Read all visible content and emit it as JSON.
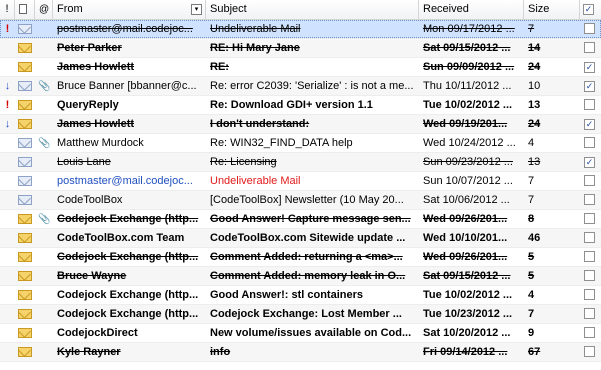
{
  "header": {
    "columns": [
      {
        "key": "flag",
        "label": "!"
      },
      {
        "key": "doc",
        "label": ""
      },
      {
        "key": "att",
        "label": "@"
      },
      {
        "key": "from",
        "label": "From"
      },
      {
        "key": "subject",
        "label": "Subject"
      },
      {
        "key": "received",
        "label": "Received"
      },
      {
        "key": "size",
        "label": "Size"
      },
      {
        "key": "check",
        "label": ""
      }
    ]
  },
  "rows": [
    {
      "priority": "!",
      "priority_type": "high",
      "read": true,
      "attach": false,
      "from": "postmaster@mail.codejoc...",
      "subject": "Undeliverable Mail",
      "received": "Mon 09/17/2012 ...",
      "size": "7",
      "checked": false,
      "bold": false,
      "strike": true,
      "from_color": "",
      "subject_color": "",
      "selected": true
    },
    {
      "priority": "",
      "priority_type": "",
      "read": false,
      "attach": false,
      "from": "Peter Parker",
      "subject": "RE: Hi Mary Jane",
      "received": "Sat 09/15/2012 ...",
      "size": "14",
      "checked": false,
      "bold": true,
      "strike": true,
      "from_color": "",
      "subject_color": "",
      "selected": false
    },
    {
      "priority": "",
      "priority_type": "",
      "read": false,
      "attach": false,
      "from": "James Howlett",
      "subject": "RE:",
      "received": "Sun 09/09/2012 ...",
      "size": "24",
      "checked": true,
      "bold": true,
      "strike": true,
      "from_color": "",
      "subject_color": "",
      "selected": false
    },
    {
      "priority": "↓",
      "priority_type": "low",
      "read": true,
      "attach": true,
      "from": "Bruce Banner [bbanner@c...",
      "subject": "Re: error C2039: 'Serialize' : is not a me...",
      "received": "Thu 10/11/2012 ...",
      "size": "10",
      "checked": true,
      "bold": false,
      "strike": false,
      "from_color": "",
      "subject_color": "",
      "selected": false
    },
    {
      "priority": "!",
      "priority_type": "high",
      "read": false,
      "attach": false,
      "from": "QueryReply",
      "subject": "Re: Download GDI+ version 1.1",
      "received": "Tue 10/02/2012 ...",
      "size": "13",
      "checked": false,
      "bold": true,
      "strike": false,
      "from_color": "",
      "subject_color": "",
      "selected": false
    },
    {
      "priority": "↓",
      "priority_type": "low",
      "read": false,
      "attach": false,
      "from": "James Howlett",
      "subject": "I don't understand:",
      "received": "Wed 09/19/201...",
      "size": "24",
      "checked": true,
      "bold": true,
      "strike": true,
      "from_color": "",
      "subject_color": "",
      "selected": false
    },
    {
      "priority": "",
      "priority_type": "",
      "read": true,
      "attach": true,
      "from": "Matthew Murdock",
      "subject": "Re: WIN32_FIND_DATA help",
      "received": "Wed 10/24/2012 ...",
      "size": "4",
      "checked": false,
      "bold": false,
      "strike": false,
      "from_color": "",
      "subject_color": "",
      "selected": false
    },
    {
      "priority": "",
      "priority_type": "",
      "read": true,
      "attach": false,
      "from": "Louis Lane",
      "subject": "Re: Licensing",
      "received": "Sun 09/23/2012 ...",
      "size": "13",
      "checked": true,
      "bold": false,
      "strike": true,
      "from_color": "",
      "subject_color": "",
      "selected": false
    },
    {
      "priority": "",
      "priority_type": "",
      "read": true,
      "attach": false,
      "from": "postmaster@mail.codejoc...",
      "subject": "Undeliverable Mail",
      "received": "Sun 10/07/2012 ...",
      "size": "7",
      "checked": false,
      "bold": false,
      "strike": false,
      "from_color": "#1f4fbf",
      "subject_color": "#e21a1a",
      "selected": false
    },
    {
      "priority": "",
      "priority_type": "",
      "read": true,
      "attach": false,
      "from": "CodeToolBox",
      "subject": "[CodeToolBox] Newsletter (10 May 20...",
      "received": "Sat 10/06/2012 ...",
      "size": "7",
      "checked": false,
      "bold": false,
      "strike": false,
      "from_color": "",
      "subject_color": "",
      "selected": false
    },
    {
      "priority": "",
      "priority_type": "",
      "read": false,
      "attach": true,
      "from": "Codejock Exchange (http...",
      "subject": "Good Answer! Capture message sen...",
      "received": "Wed 09/26/201...",
      "size": "8",
      "checked": false,
      "bold": true,
      "strike": true,
      "from_color": "",
      "subject_color": "",
      "selected": false
    },
    {
      "priority": "",
      "priority_type": "",
      "read": false,
      "attach": false,
      "from": "CodeToolBox.com Team",
      "subject": "CodeToolBox.com Sitewide update ...",
      "received": "Wed 10/10/201...",
      "size": "46",
      "checked": false,
      "bold": true,
      "strike": false,
      "from_color": "",
      "subject_color": "",
      "selected": false
    },
    {
      "priority": "",
      "priority_type": "",
      "read": false,
      "attach": false,
      "from": "Codejock Exchange (http...",
      "subject": "Comment Added: returning a <ma>...",
      "received": "Wed 09/26/201...",
      "size": "5",
      "checked": false,
      "bold": true,
      "strike": true,
      "from_color": "",
      "subject_color": "",
      "selected": false
    },
    {
      "priority": "",
      "priority_type": "",
      "read": false,
      "attach": false,
      "from": "Bruce Wayne",
      "subject": "Comment Added: memory leak in O...",
      "received": "Sat 09/15/2012 ...",
      "size": "5",
      "checked": false,
      "bold": true,
      "strike": true,
      "from_color": "",
      "subject_color": "",
      "selected": false
    },
    {
      "priority": "",
      "priority_type": "",
      "read": false,
      "attach": false,
      "from": "Codejock Exchange (http...",
      "subject": "Good Answer!: stl containers",
      "received": "Tue 10/02/2012 ...",
      "size": "4",
      "checked": false,
      "bold": true,
      "strike": false,
      "from_color": "",
      "subject_color": "",
      "selected": false
    },
    {
      "priority": "",
      "priority_type": "",
      "read": false,
      "attach": false,
      "from": "Codejock Exchange (http...",
      "subject": "Codejock Exchange: Lost Member ...",
      "received": "Tue 10/23/2012 ...",
      "size": "7",
      "checked": false,
      "bold": true,
      "strike": false,
      "from_color": "",
      "subject_color": "",
      "selected": false
    },
    {
      "priority": "",
      "priority_type": "",
      "read": false,
      "attach": false,
      "from": "CodejockDirect",
      "subject": "New volume/issues available on Cod...",
      "received": "Sat 10/20/2012 ...",
      "size": "9",
      "checked": false,
      "bold": true,
      "strike": false,
      "from_color": "",
      "subject_color": "",
      "selected": false
    },
    {
      "priority": "",
      "priority_type": "",
      "read": false,
      "attach": false,
      "from": "Kyle Rayner",
      "subject": "info",
      "received": "Fri 09/14/2012 ...",
      "size": "67",
      "checked": false,
      "bold": true,
      "strike": true,
      "from_color": "",
      "subject_color": "",
      "selected": false
    }
  ]
}
